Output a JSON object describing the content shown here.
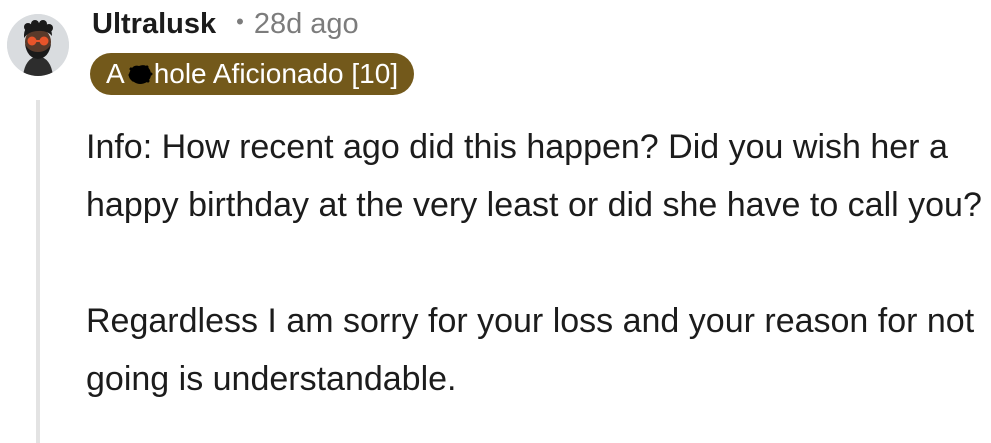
{
  "comment": {
    "username": "Ultralusk",
    "separator": "•",
    "timestamp": "28d ago",
    "flair": {
      "prefix": "A",
      "censor_icon": "scribble-redaction-icon",
      "suffix": "hole Aficionado [10]",
      "background_color": "#73591b",
      "text_color": "#ffffff"
    },
    "avatar": {
      "icon": "snoo-avatar-icon",
      "description_colors": {
        "background": "#d9dcdf",
        "hair": "#1a1a1a",
        "skin": "#5a3a2a",
        "glasses": "#e8542a"
      }
    },
    "paragraphs": [
      "Info: How recent ago did this happen? Did you wish her a happy birthday at the very least or did she have to call you?",
      "Regardless I am sorry for your loss and your reason for not going is understandable."
    ]
  }
}
